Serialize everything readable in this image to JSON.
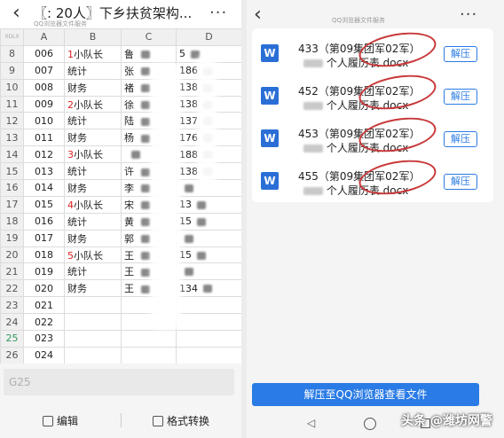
{
  "left": {
    "title": "〖:    20人〗下乡扶贫架构...",
    "subtitle": "QQ浏览器文件服务",
    "more": "···",
    "sheet": {
      "corner": "XDLX",
      "columns": [
        "A",
        "B",
        "C",
        "D"
      ],
      "rows": [
        {
          "num": "8",
          "a": "006",
          "b_prefix": "1",
          "b": "小队长"
        },
        {
          "num": "9",
          "a": "007",
          "b_prefix": "",
          "b": "统计"
        },
        {
          "num": "10",
          "a": "008",
          "b_prefix": "",
          "b": "财务"
        },
        {
          "num": "11",
          "a": "009",
          "b_prefix": "2",
          "b": "小队长"
        },
        {
          "num": "12",
          "a": "010",
          "b_prefix": "",
          "b": "统计"
        },
        {
          "num": "13",
          "a": "011",
          "b_prefix": "",
          "b": "财务"
        },
        {
          "num": "14",
          "a": "012",
          "b_prefix": "3",
          "b": "小队长"
        },
        {
          "num": "15",
          "a": "013",
          "b_prefix": "",
          "b": "统计"
        },
        {
          "num": "16",
          "a": "014",
          "b_prefix": "",
          "b": "财务"
        },
        {
          "num": "17",
          "a": "015",
          "b_prefix": "4",
          "b": "小队长"
        },
        {
          "num": "18",
          "a": "016",
          "b_prefix": "",
          "b": "统计"
        },
        {
          "num": "19",
          "a": "017",
          "b_prefix": "",
          "b": "财务"
        },
        {
          "num": "20",
          "a": "018",
          "b_prefix": "5",
          "b": "小队长"
        },
        {
          "num": "21",
          "a": "019",
          "b_prefix": "",
          "b": "统计"
        },
        {
          "num": "22",
          "a": "020",
          "b_prefix": "",
          "b": "财务"
        },
        {
          "num": "23",
          "a": "021",
          "b_prefix": "",
          "b": ""
        },
        {
          "num": "24",
          "a": "022",
          "b_prefix": "",
          "b": ""
        },
        {
          "num": "25",
          "a": "023",
          "b_prefix": "",
          "b": ""
        },
        {
          "num": "26",
          "a": "024",
          "b_prefix": "",
          "b": ""
        }
      ],
      "partial_c": [
        "鲁",
        "张",
        "褚",
        "徐",
        "陆",
        "杨",
        "",
        "许",
        "李",
        "宋",
        "黄",
        "郭",
        "王",
        "王",
        "王",
        "",
        "",
        "",
        ""
      ],
      "partial_d": [
        "5",
        "186",
        "138",
        "138",
        "137",
        "176",
        "188",
        "138",
        "",
        "13",
        "15",
        "",
        "15",
        "",
        "134",
        "",
        "",
        "",
        ""
      ]
    },
    "formula_cell": "G25",
    "toolbar": {
      "edit": "编辑",
      "convert": "格式转换"
    }
  },
  "right": {
    "subtitle": "QQ浏览器文件服务",
    "more": "···",
    "files": [
      {
        "line1": "433（第09集团军02军）",
        "line2": "个人履历表.docx",
        "action": "解压"
      },
      {
        "line1": "452（第09集团军02军）",
        "line2": "个人履历表.docx",
        "action": "解压"
      },
      {
        "line1": "453（第09集团军02军）",
        "line2": "个人履历表.docx",
        "action": "解压"
      },
      {
        "line1": "455（第09集团军02军）",
        "line2": "个人履历表.docx",
        "action": "解压"
      }
    ],
    "main_button": "解压至QQ浏览器查看文件"
  },
  "watermark": "头条 @潍坊网警",
  "colors": {
    "accent": "#2a7be5",
    "red": "#e02020",
    "annotation": "#c8383a",
    "word": "#2a6fd6"
  }
}
